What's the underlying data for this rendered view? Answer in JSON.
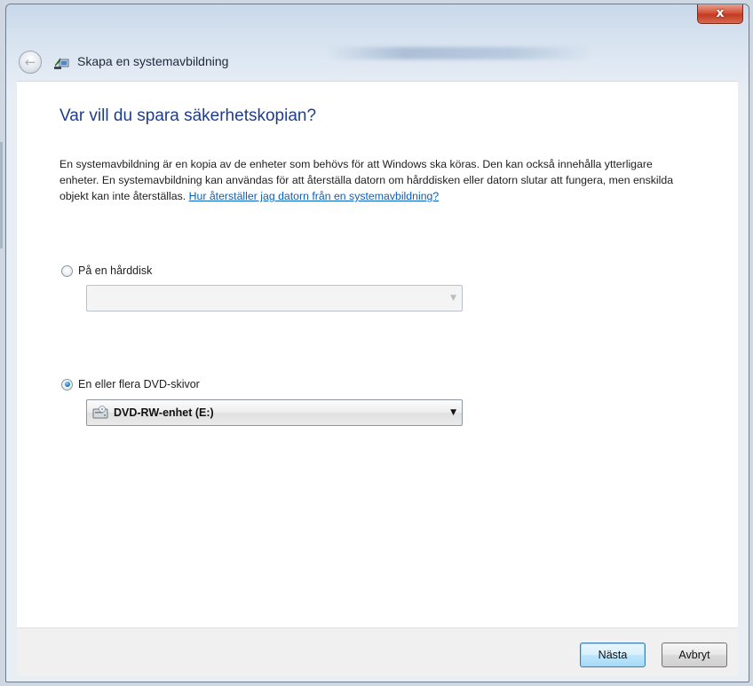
{
  "window": {
    "title": "Skapa en systemavbildning",
    "close_label": "x"
  },
  "page": {
    "heading": "Var vill du spara säkerhetskopian?",
    "description": "En systemavbildning är en kopia av de enheter som behövs för att Windows ska köras. Den kan också innehålla ytterligare enheter. En systemavbildning kan användas för att återställa datorn om hårddisken eller datorn slutar att fungera, men enskilda objekt kan inte återställas.",
    "help_link": "Hur återställer jag datorn från en systemavbildning?"
  },
  "options": {
    "hard_disk": {
      "label": "På en hårddisk",
      "selected": false,
      "value": ""
    },
    "dvd": {
      "label": "En eller flera DVD-skivor",
      "selected": true,
      "value": "DVD-RW-enhet (E:)"
    }
  },
  "buttons": {
    "next": "Nästa",
    "cancel": "Avbryt"
  },
  "icons": {
    "back": "back-arrow-icon",
    "app": "system-image-icon",
    "drive": "dvd-drive-icon",
    "dropdown": "chevron-down-icon"
  },
  "colors": {
    "heading": "#1f3d8f",
    "link": "#0a5fbf",
    "close_button": "#c23a22",
    "primary_button": "#bee6fd"
  }
}
